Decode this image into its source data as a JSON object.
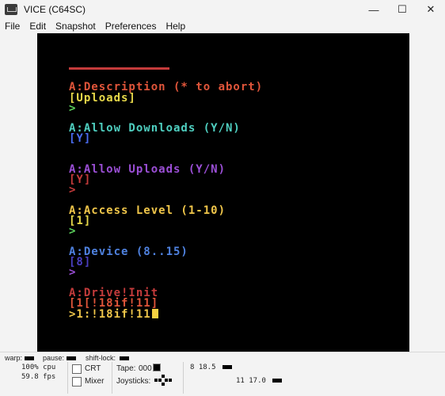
{
  "window": {
    "title": "VICE (C64SC)",
    "controls": {
      "minimize": "—",
      "maximize": "☐",
      "close": "✕"
    }
  },
  "menu": [
    "File",
    "Edit",
    "Snapshot",
    "Preferences",
    "Help"
  ],
  "screen": {
    "lines": [
      {
        "text": "A:Description (* to abort)",
        "color": "#e0553a"
      },
      {
        "text": "[Uploads]",
        "color": "#e8d94a"
      },
      {
        "text": ">",
        "color": "#5cd05c"
      },
      {
        "text": "A:Allow Downloads (Y/N)",
        "color": "#4fcfc0"
      },
      {
        "text": "[Y]",
        "color": "#4a6cf0"
      },
      {
        "text": "A:Allow Uploads (Y/N)",
        "color": "#9b4fd6"
      },
      {
        "text": "[Y]",
        "color": "#c43b3b"
      },
      {
        "text": ">",
        "color": "#c43b3b"
      },
      {
        "text": "A:Access Level (1-10)",
        "color": "#f0c64a"
      },
      {
        "text": "[1]",
        "color": "#e8d94a"
      },
      {
        "text": ">",
        "color": "#5cd05c"
      },
      {
        "text": "A:Device (8..15)",
        "color": "#4f82e0"
      },
      {
        "text": "[8]",
        "color": "#4a3fc0"
      },
      {
        "text": ">",
        "color": "#9b4fd6"
      },
      {
        "text": "A:Drive!Init",
        "color": "#c43b3b"
      },
      {
        "text": "[1[!18if!11]",
        "color": "#e0553a"
      },
      {
        "text": ">1:!18if!11",
        "color": "#f0c64a"
      }
    ],
    "divider_color": "#c43b3b",
    "cursor_color": "#f5d142"
  },
  "status": {
    "warp_label": "warp:",
    "pause_label": "pause:",
    "shiftlock_label": "shift-lock:",
    "cpu": "100% cpu",
    "fps": "59.8 fps",
    "crt_label": "CRT",
    "mixer_label": "Mixer",
    "tape_label": "Tape:",
    "tape_counter": "000",
    "joysticks_label": "Joysticks:",
    "drive8": "8 18.5",
    "drive11": "11 17.0"
  }
}
